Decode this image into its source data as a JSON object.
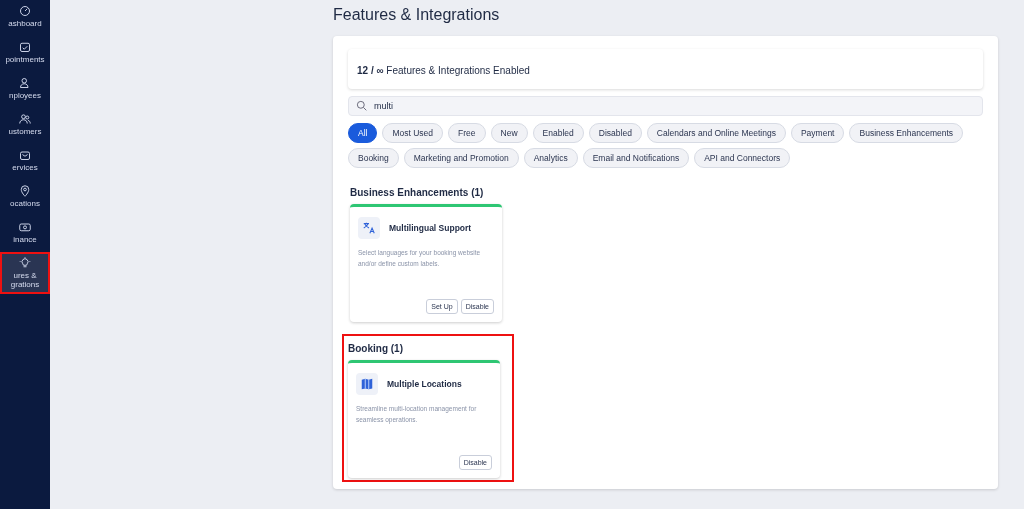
{
  "sidebar": {
    "items": [
      {
        "label": "ashboard",
        "selected": false,
        "highlighted": false
      },
      {
        "label": "pointments",
        "selected": false,
        "highlighted": false
      },
      {
        "label": "nployees",
        "selected": false,
        "highlighted": false
      },
      {
        "label": "ustomers",
        "selected": false,
        "highlighted": false
      },
      {
        "label": "ervices",
        "selected": false,
        "highlighted": false
      },
      {
        "label": "ocations",
        "selected": false,
        "highlighted": false
      },
      {
        "label": "inance",
        "selected": false,
        "highlighted": false
      },
      {
        "label": "ures & grations",
        "selected": true,
        "highlighted": true
      }
    ]
  },
  "page": {
    "title": "Features & Integrations"
  },
  "summary": {
    "count": "12 / ∞",
    "text": "Features & Integrations Enabled"
  },
  "search": {
    "value": "multi"
  },
  "filters": [
    {
      "label": "All",
      "selected": true
    },
    {
      "label": "Most Used",
      "selected": false
    },
    {
      "label": "Free",
      "selected": false
    },
    {
      "label": "New",
      "selected": false
    },
    {
      "label": "Enabled",
      "selected": false
    },
    {
      "label": "Disabled",
      "selected": false
    },
    {
      "label": "Calendars and Online Meetings",
      "selected": false
    },
    {
      "label": "Payment",
      "selected": false
    },
    {
      "label": "Business Enhancements",
      "selected": false
    },
    {
      "label": "Booking",
      "selected": false
    },
    {
      "label": "Marketing and Promotion",
      "selected": false
    },
    {
      "label": "Analytics",
      "selected": false
    },
    {
      "label": "Email and Notifications",
      "selected": false
    },
    {
      "label": "API and Connectors",
      "selected": false
    }
  ],
  "sections": [
    {
      "title": "Business Enhancements (1)",
      "highlighted": false,
      "cards": [
        {
          "name": "Multilingual Support",
          "enabled": true,
          "description": "Select languages for your booking website and/or define custom labels.",
          "buttons": [
            "Set Up",
            "Disable"
          ]
        }
      ]
    },
    {
      "title": "Booking (1)",
      "highlighted": true,
      "cards": [
        {
          "name": "Multiple Locations",
          "enabled": true,
          "description": "Streamline multi-location management for seamless operations.",
          "buttons": [
            "Disable"
          ]
        }
      ]
    }
  ]
}
